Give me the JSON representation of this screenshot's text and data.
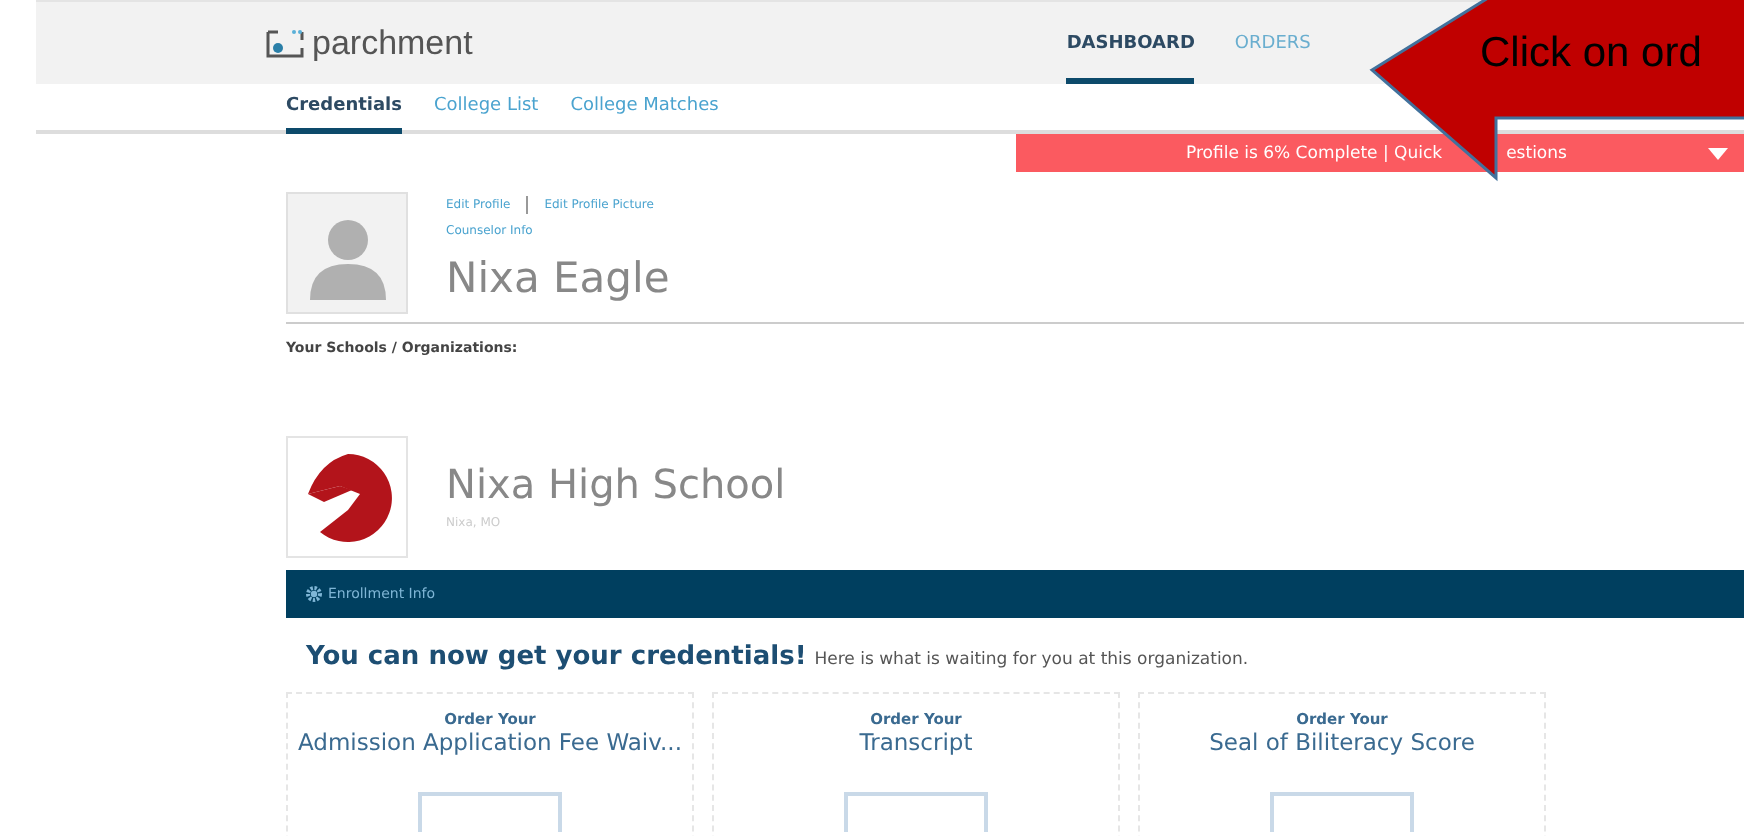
{
  "header": {
    "logo": "parchment",
    "nav": [
      {
        "label": "DASHBOARD",
        "selected": true
      },
      {
        "label": "ORDERS",
        "selected": false
      }
    ]
  },
  "tabs": [
    {
      "label": "Credentials",
      "selected": true
    },
    {
      "label": "College List",
      "selected": false
    },
    {
      "label": "College Matches",
      "selected": false
    }
  ],
  "profile_banner": {
    "text_left": "Profile is 6% Complete | Quick",
    "text_right": "estions"
  },
  "profile": {
    "links": [
      "Edit Profile",
      "Edit Profile Picture"
    ],
    "counselor_link": "Counselor Info",
    "name": "Nixa Eagle"
  },
  "schools_label": "Your Schools / Organizations:",
  "school": {
    "name": "Nixa High School",
    "location": "Nixa, MO",
    "bar_label": "Enrollment Info"
  },
  "credentials_heading": {
    "title": "You can now get your credentials!",
    "subtitle": "Here is what is waiting for you at this organization."
  },
  "cards": [
    {
      "kicker": "Order Your",
      "title": "Admission Application Fee Waiv..."
    },
    {
      "kicker": "Order Your",
      "title": "Transcript"
    },
    {
      "kicker": "Order Your",
      "title": "Seal of Biliteracy Score"
    }
  ],
  "callout": {
    "text": "Click on ord"
  }
}
